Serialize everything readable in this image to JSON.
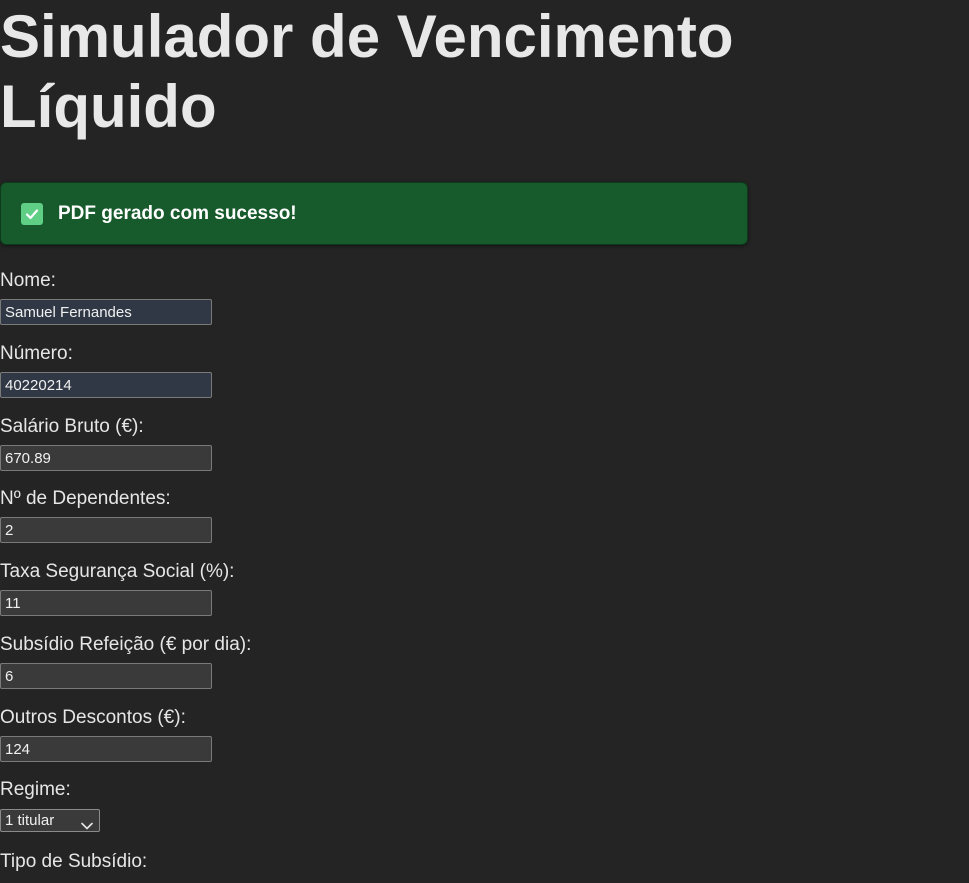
{
  "page": {
    "title": "Simulador de Vencimento Líquido"
  },
  "banner": {
    "icon": "check-icon",
    "text": "PDF gerado com sucesso!",
    "color": "#175a2b"
  },
  "form": {
    "nome": {
      "label": "Nome:",
      "value": "Samuel Fernandes"
    },
    "numero": {
      "label": "Número:",
      "value": "40220214"
    },
    "salario": {
      "label": "Salário Bruto (€):",
      "value": "670.89"
    },
    "dependentes": {
      "label": "Nº de Dependentes:",
      "value": "2"
    },
    "taxa_ss": {
      "label": "Taxa Segurança Social (%):",
      "value": "11"
    },
    "subsidio_refeicao": {
      "label": "Subsídio Refeição (€ por dia):",
      "value": "6"
    },
    "outros_descontos": {
      "label": "Outros Descontos (€):",
      "value": "124"
    },
    "regime": {
      "label": "Regime:",
      "selected": "1 titular"
    },
    "tipo_subsidio": {
      "label": "Tipo de Subsídio:"
    }
  }
}
